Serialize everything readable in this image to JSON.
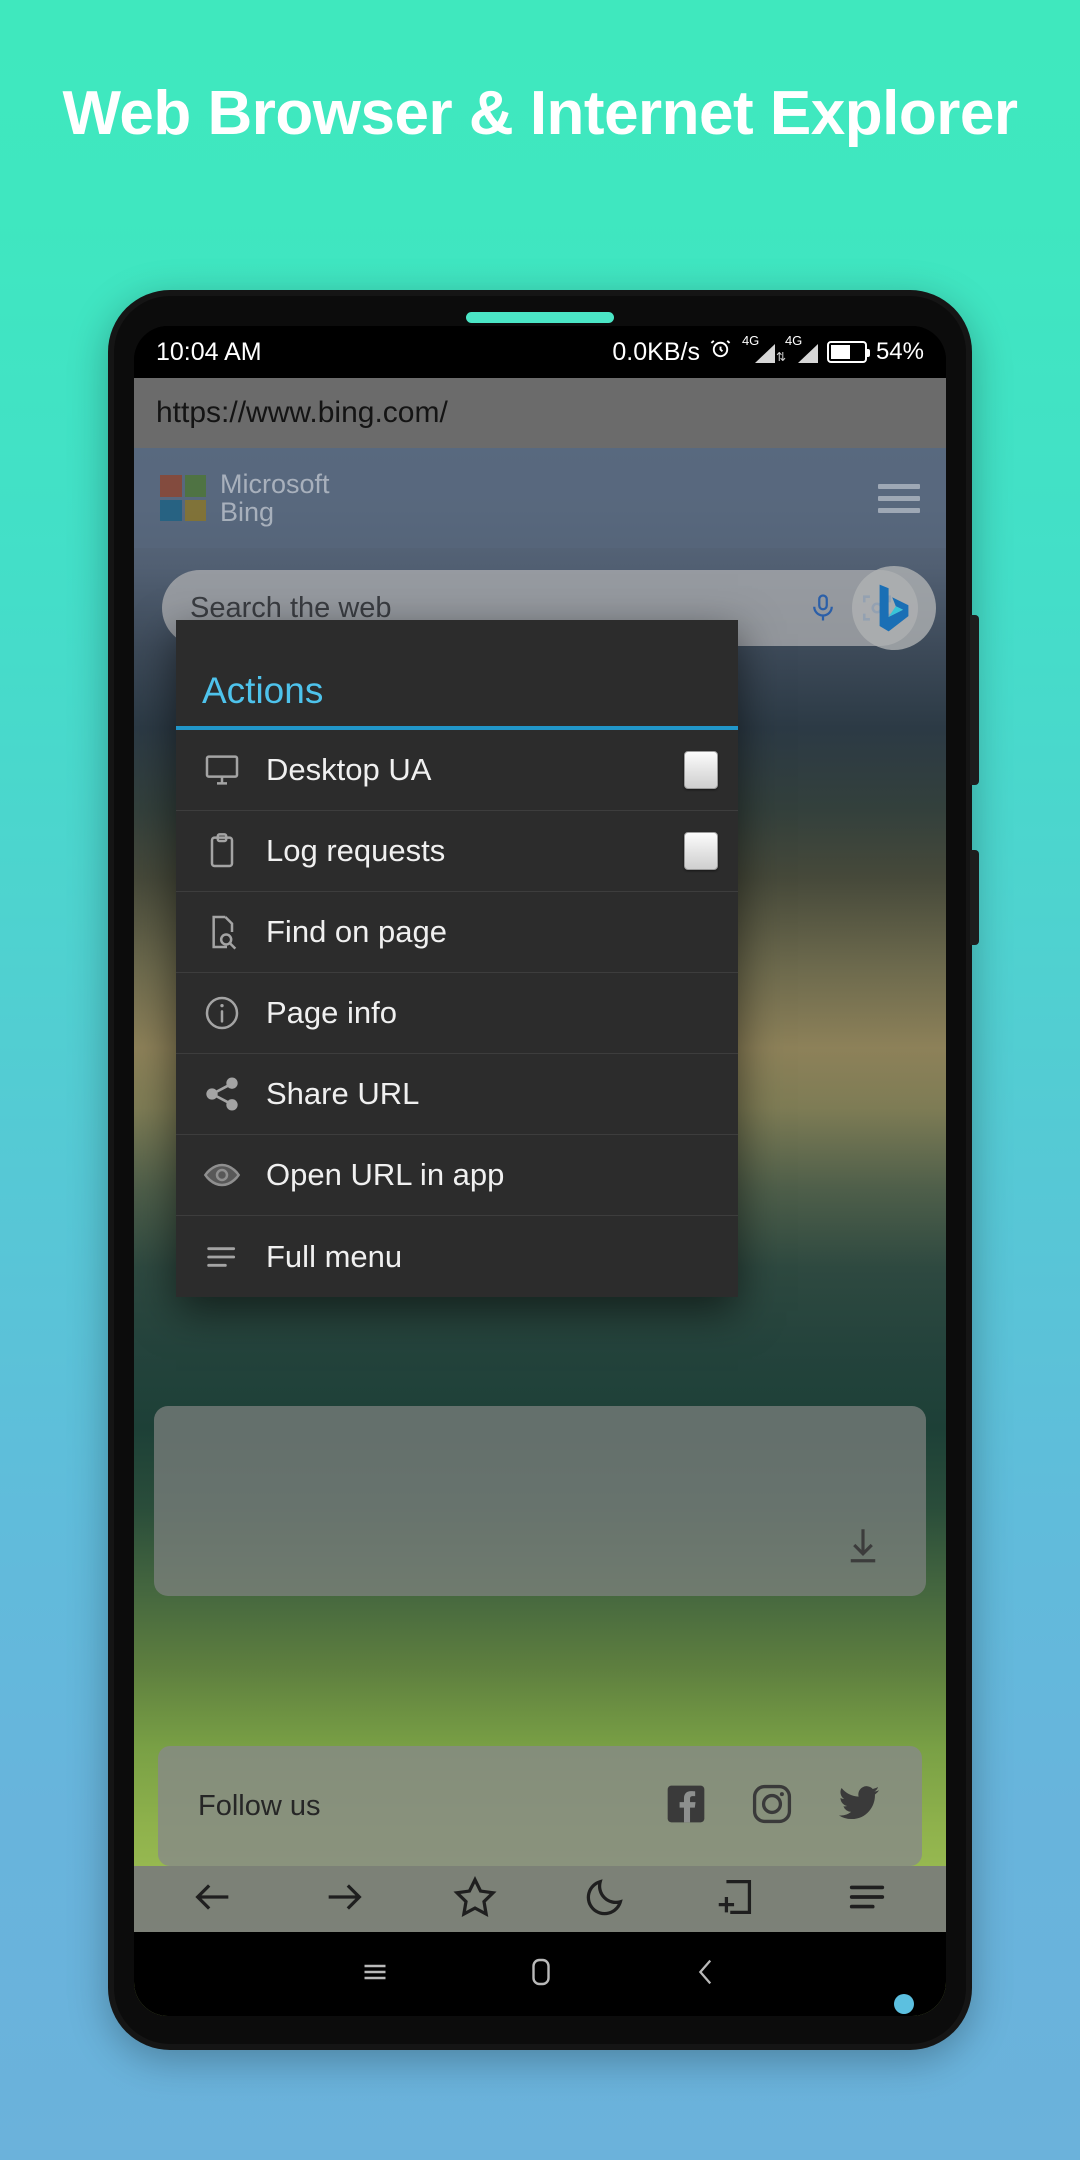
{
  "headline": "Web Browser & Internet Explorer",
  "theme": {
    "bg_top": "#3FE8BE",
    "bg_bottom": "#6BB2DB",
    "accent_blue": "#4ec3ec",
    "divider_blue": "#2196c9",
    "dialog_bg": "#2c2c2c"
  },
  "status_bar": {
    "time": "10:04 AM",
    "network_speed": "0.0KB/s",
    "alarm_icon": "alarm-clock-icon",
    "sim1_network": "4G",
    "sim2_network": "4G",
    "battery_icon": "battery-icon",
    "battery_percent": "54%"
  },
  "browser": {
    "url": "https://www.bing.com/",
    "page": {
      "brand_line1": "Microsoft",
      "brand_line2": "Bing",
      "menu_icon": "hamburger-menu-icon",
      "search_placeholder": "Search the web",
      "search_value": "",
      "mic_icon": "microphone-icon",
      "lens_icon": "visual-search-icon",
      "bing_logo_icon": "bing-logo-icon",
      "download_icon": "download-icon",
      "follow_label": "Follow us",
      "social": [
        {
          "name": "facebook-icon",
          "label": "Facebook"
        },
        {
          "name": "instagram-icon",
          "label": "Instagram"
        },
        {
          "name": "twitter-icon",
          "label": "Twitter"
        }
      ]
    },
    "toolbar": [
      {
        "name": "back-button",
        "icon": "arrow-left-icon"
      },
      {
        "name": "forward-button",
        "icon": "arrow-right-icon"
      },
      {
        "name": "bookmarks-button",
        "icon": "star-icon"
      },
      {
        "name": "night-mode-button",
        "icon": "moon-icon"
      },
      {
        "name": "new-tab-button",
        "icon": "new-tab-icon"
      },
      {
        "name": "menu-button",
        "icon": "list-menu-icon"
      }
    ]
  },
  "dialog": {
    "title": "Actions",
    "items": [
      {
        "label": "Desktop UA",
        "icon": "monitor-icon",
        "control": "checkbox",
        "checked": false
      },
      {
        "label": "Log requests",
        "icon": "clipboard-icon",
        "control": "checkbox",
        "checked": false
      },
      {
        "label": "Find on page",
        "icon": "find-in-page-icon",
        "control": "none"
      },
      {
        "label": "Page info",
        "icon": "info-circle-icon",
        "control": "none"
      },
      {
        "label": "Share URL",
        "icon": "share-icon",
        "control": "none"
      },
      {
        "label": "Open URL in app",
        "icon": "eye-icon",
        "control": "none"
      },
      {
        "label": "Full menu",
        "icon": "list-menu-icon",
        "control": "none"
      }
    ]
  },
  "android_nav": [
    {
      "name": "recents-button",
      "icon": "recents-icon"
    },
    {
      "name": "home-button",
      "icon": "home-icon"
    },
    {
      "name": "back-button",
      "icon": "chevron-left-icon"
    }
  ]
}
